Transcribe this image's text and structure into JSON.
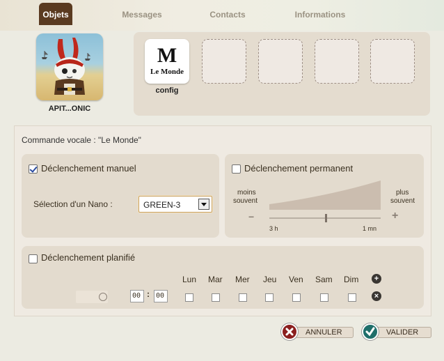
{
  "tabs": [
    {
      "label": "Objets",
      "active": true
    },
    {
      "label": "Messages",
      "active": false
    },
    {
      "label": "Contacts",
      "active": false
    },
    {
      "label": "Informations",
      "active": false
    }
  ],
  "owner": {
    "name": "APIT...ONIC"
  },
  "slots": {
    "filled_label": "config",
    "filled_logo_letter": "M",
    "filled_logo_text": "Le Monde"
  },
  "voice_command": "Commande vocale : \"Le Monde\"",
  "manual": {
    "label": "Déclenchement manuel",
    "checked": true,
    "nano_label": "Sélection d'un Nano :",
    "nano_value": "GREEN-3"
  },
  "permanent": {
    "label": "Déclenchement permanent",
    "checked": false,
    "less_label_1": "moins",
    "less_label_2": "souvent",
    "more_label_1": "plus",
    "more_label_2": "souvent",
    "minus": "−",
    "plus": "+",
    "min_tick": "3 h",
    "max_tick": "1 mn"
  },
  "planned": {
    "label": "Déclenchement planifié",
    "checked": false,
    "days": [
      "Lun",
      "Mar",
      "Mer",
      "Jeu",
      "Ven",
      "Sam",
      "Dim"
    ],
    "hour": "00",
    "minute": "00",
    "separator": ":",
    "add_symbol": "+",
    "remove_symbol": "×"
  },
  "buttons": {
    "cancel": "ANNULER",
    "validate": "VALIDER"
  },
  "colors": {
    "accent": "#5a3a20",
    "cancel_icon": "#8b1f1f",
    "validate_icon": "#1e6e6a"
  }
}
